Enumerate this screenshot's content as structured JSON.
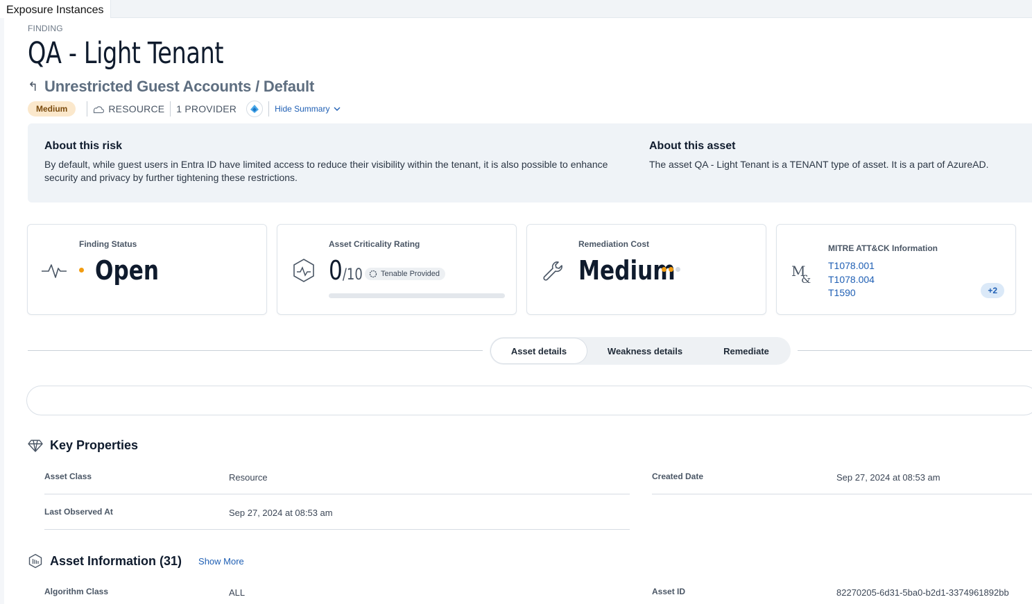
{
  "window": {
    "tab_title": "Exposure Instances"
  },
  "header": {
    "eyebrow": "FINDING",
    "title": "QA - Light Tenant",
    "subtitle": "Unrestricted Guest Accounts / Default",
    "severity": "Medium",
    "resource_label": "RESOURCE",
    "provider_label": "1 PROVIDER",
    "hide_summary_label": "Hide Summary"
  },
  "about": {
    "risk_title": "About this risk",
    "risk_text": "By default, while guest users in Entra ID have limited access to reduce their visibility within the tenant, it is also possible to enhance security and privacy by further tightening these restrictions.",
    "asset_title": "About this asset",
    "asset_text": "The asset QA - Light Tenant is a TENANT type of asset. It is a part of AzureAD."
  },
  "cards": {
    "status": {
      "label": "Finding Status",
      "value": "Open"
    },
    "criticality": {
      "label": "Asset Criticality Rating",
      "value": "0",
      "scale": "/10",
      "badge": "Tenable Provided",
      "progress_fraction": 0.0
    },
    "cost": {
      "label": "Remediation Cost",
      "value": "Medium",
      "level": 2,
      "max_level": 3
    },
    "mitre": {
      "label": "MITRE ATT&CK Information",
      "techniques": [
        "T1078.001",
        "T1078.004",
        "T1590"
      ],
      "more": "+2"
    }
  },
  "tabs": [
    "Asset details",
    "Weakness details",
    "Remediate"
  ],
  "key_properties": {
    "title": "Key Properties",
    "items": [
      {
        "label": "Asset Class",
        "value": "Resource"
      },
      {
        "label": "Created Date",
        "value": "Sep 27, 2024 at 08:53 am"
      },
      {
        "label": "Last Observed At",
        "value": "Sep 27, 2024 at 08:53 am"
      }
    ]
  },
  "asset_information": {
    "title": "Asset Information (31)",
    "show_more": "Show More",
    "items": [
      {
        "label": "Algorithm Class",
        "value": "ALL"
      },
      {
        "label": "Asset ID",
        "value": "82270205-6d31-5ba0-b2d1-3374961892bb"
      }
    ]
  },
  "colors": {
    "accent": "#1f5fb4",
    "status_dot": "#f29c11",
    "severity_bg": "#fbe8cc"
  }
}
